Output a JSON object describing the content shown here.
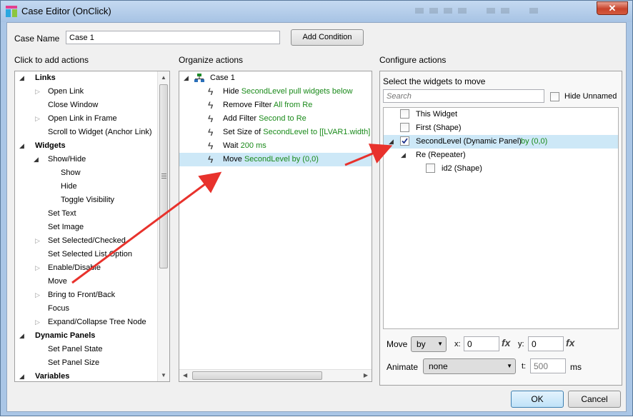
{
  "window": {
    "title": "Case Editor (OnClick)",
    "close_glyph": "✕"
  },
  "case_name": {
    "label": "Case Name",
    "value": "Case 1",
    "add_condition": "Add Condition"
  },
  "left": {
    "heading": "Click to add actions",
    "items": [
      {
        "text": "Links",
        "kind": "group"
      },
      {
        "text": "Open Link",
        "kind": "item"
      },
      {
        "text": "Close Window",
        "kind": "item"
      },
      {
        "text": "Open Link in Frame",
        "kind": "item"
      },
      {
        "text": "Scroll to Widget (Anchor Link)",
        "kind": "item"
      },
      {
        "text": "Widgets",
        "kind": "group"
      },
      {
        "text": "Show/Hide",
        "kind": "subgroup"
      },
      {
        "text": "Show",
        "kind": "subitem"
      },
      {
        "text": "Hide",
        "kind": "subitem"
      },
      {
        "text": "Toggle Visibility",
        "kind": "subitem"
      },
      {
        "text": "Set Text",
        "kind": "item"
      },
      {
        "text": "Set Image",
        "kind": "item"
      },
      {
        "text": "Set Selected/Checked",
        "kind": "item"
      },
      {
        "text": "Set Selected List Option",
        "kind": "item"
      },
      {
        "text": "Enable/Disable",
        "kind": "item"
      },
      {
        "text": "Move",
        "kind": "item"
      },
      {
        "text": "Bring to Front/Back",
        "kind": "item"
      },
      {
        "text": "Focus",
        "kind": "item"
      },
      {
        "text": "Expand/Collapse Tree Node",
        "kind": "item"
      },
      {
        "text": "Dynamic Panels",
        "kind": "group"
      },
      {
        "text": "Set Panel State",
        "kind": "item"
      },
      {
        "text": "Set Panel Size",
        "kind": "item"
      },
      {
        "text": "Variables",
        "kind": "group"
      }
    ]
  },
  "middle": {
    "heading": "Organize actions",
    "case_label": "Case 1",
    "actions": [
      {
        "verb": "Hide ",
        "target": "SecondLevel pull widgets below"
      },
      {
        "verb": "Remove Filter ",
        "target": "All from Re"
      },
      {
        "verb": "Add Filter ",
        "target": "Second to Re"
      },
      {
        "verb": "Set Size of ",
        "target": "SecondLevel to [[LVAR1.width]"
      },
      {
        "verb": "Wait ",
        "target": "200 ms"
      },
      {
        "verb": "Move ",
        "target": "SecondLevel by (0,0)"
      }
    ]
  },
  "right": {
    "heading": "Configure actions",
    "subheading": "Select the widgets to move",
    "search_placeholder": "Search",
    "hide_unnamed": "Hide Unnamed",
    "widgets": [
      {
        "label": "This Widget",
        "checked": false
      },
      {
        "label": "First (Shape)",
        "checked": false
      },
      {
        "label": "SecondLevel (Dynamic Panel)",
        "suffix": " by (0,0)",
        "checked": true
      },
      {
        "label": "Re (Repeater)"
      },
      {
        "label": "id2 (Shape)",
        "checked": false
      }
    ],
    "move_label": "Move",
    "move_mode": "by",
    "x_label": "x:",
    "x_value": "0",
    "y_label": "y:",
    "y_value": "0",
    "fx": "fx",
    "animate_label": "Animate",
    "animate_value": "none",
    "t_label": "t:",
    "t_value": "500",
    "ms": "ms"
  },
  "footer": {
    "ok": "OK",
    "cancel": "Cancel"
  },
  "colors": {
    "action_green": "#1a8a1a",
    "selection": "#cde8f7",
    "arrow": "#e8322c"
  }
}
